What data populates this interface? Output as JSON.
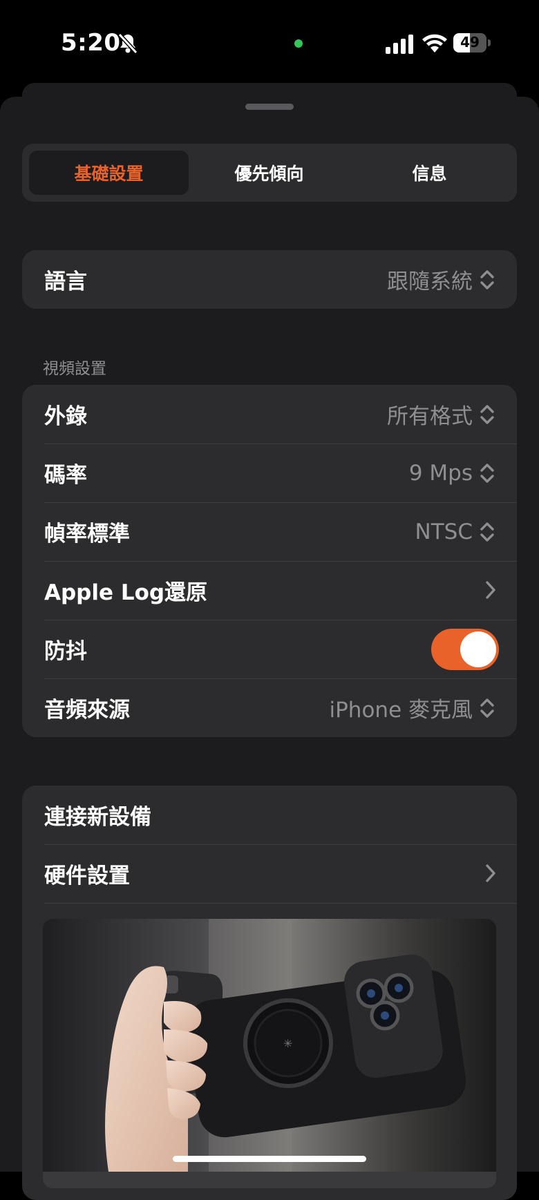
{
  "status_bar": {
    "time": "5:20",
    "battery": "49",
    "battery_level": 0.49
  },
  "tabs": [
    {
      "label": "基礎設置",
      "active": true
    },
    {
      "label": "優先傾向",
      "active": false
    },
    {
      "label": "信息",
      "active": false
    }
  ],
  "language": {
    "label": "語言",
    "value": "跟隨系統"
  },
  "video_settings": {
    "header": "視頻設置",
    "rows": [
      {
        "label": "外錄",
        "value": "所有格式",
        "control": "selector"
      },
      {
        "label": "碼率",
        "value": "9 Mps",
        "control": "selector"
      },
      {
        "label": "幀率標準",
        "value": "NTSC",
        "control": "selector"
      },
      {
        "label": "Apple Log還原",
        "control": "disclosure"
      },
      {
        "label": "防抖",
        "control": "toggle",
        "on": true
      },
      {
        "label": "音頻來源",
        "value": "iPhone 麥克風",
        "control": "selector"
      }
    ]
  },
  "device": {
    "connect_label": "連接新設備",
    "hardware_label": "硬件設置"
  },
  "colors": {
    "accent": "#e8622a",
    "sheet": "#1c1c1e",
    "card": "#2c2c2e",
    "secondary_text": "#8e8e93"
  },
  "icons": [
    "bell-slash-icon",
    "cellular-signal-icon",
    "wifi-icon",
    "battery-icon",
    "chevron-up-down-icon",
    "chevron-right-icon"
  ]
}
